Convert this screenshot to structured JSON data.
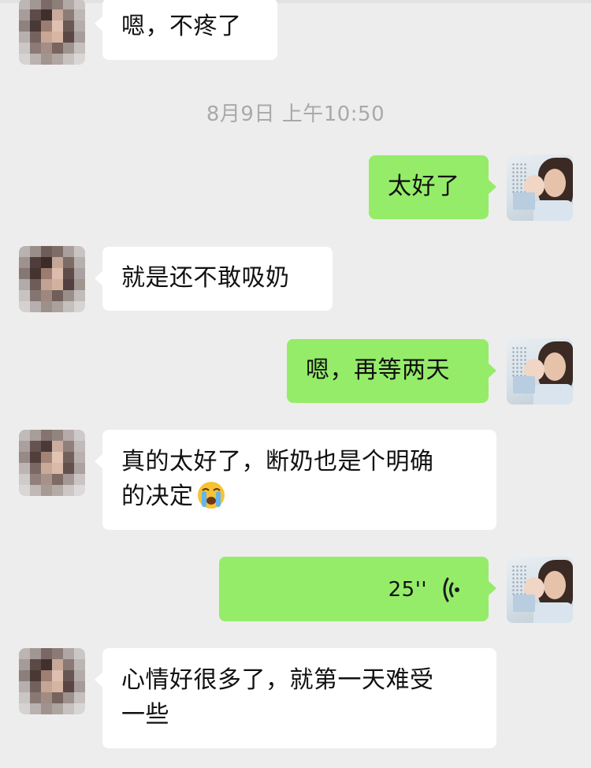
{
  "timestamp": "8月9日 上午10:50",
  "messages": [
    {
      "side": "in",
      "text": "嗯，不疼了"
    },
    {
      "side": "out",
      "text": "太好了"
    },
    {
      "side": "in",
      "text": "就是还不敢吸奶"
    },
    {
      "side": "out",
      "text": "嗯，再等两天"
    },
    {
      "side": "in",
      "line1": "真的太好了，断奶也是个明确",
      "line2": "的决定",
      "emoji": "loudly-crying-face-emoji"
    },
    {
      "side": "out",
      "type": "voice",
      "duration": "25''",
      "icon": "voice-wave-icon"
    },
    {
      "side": "in",
      "line1": "心情好很多了，就第一天难受",
      "line2": "一些"
    }
  ],
  "colors": {
    "background": "#ededed",
    "incoming_bubble": "#ffffff",
    "outgoing_bubble": "#95ec69",
    "timestamp_text": "#a9a9a9"
  },
  "avatars": {
    "contact": "pixelated-avatar",
    "self": "brand-avatar-mother-and-child"
  }
}
